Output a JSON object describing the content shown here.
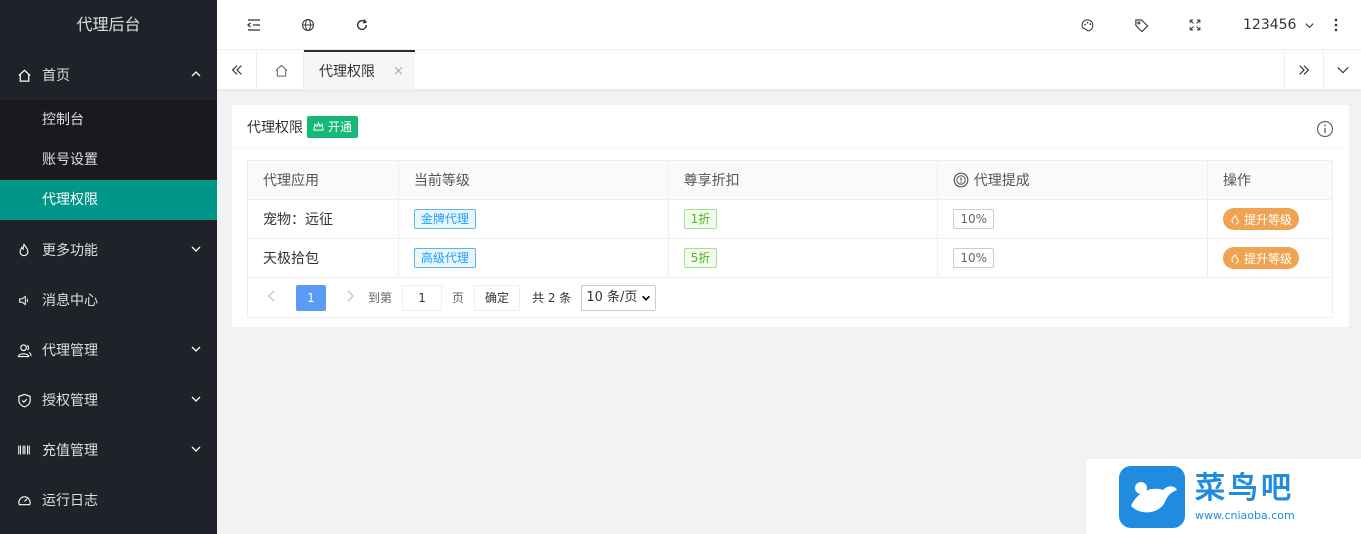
{
  "sidebar": {
    "logo": "代理后台",
    "home": "首页",
    "sub_items": [
      "控制台",
      "账号设置",
      "代理权限"
    ],
    "items": [
      {
        "label": "更多功能",
        "icon": "fire-icon"
      },
      {
        "label": "消息中心",
        "icon": "speaker-icon"
      },
      {
        "label": "代理管理",
        "icon": "users-icon"
      },
      {
        "label": "授权管理",
        "icon": "shield-icon"
      },
      {
        "label": "充值管理",
        "icon": "barcode-icon"
      },
      {
        "label": "运行日志",
        "icon": "gauge-icon"
      }
    ]
  },
  "header": {
    "username": "123456"
  },
  "tabs": {
    "active": "代理权限",
    "close": "×"
  },
  "card": {
    "title": "代理权限",
    "badge": "开通",
    "columns": [
      "代理应用",
      "当前等级",
      "尊享折扣",
      "代理提成",
      "操作"
    ],
    "rows": [
      {
        "app": "宠物：远征",
        "level": "金牌代理",
        "discount": "1折",
        "commission": "10%",
        "action": "提升等级"
      },
      {
        "app": "天极拾包",
        "level": "高级代理",
        "discount": "5折",
        "commission": "10%",
        "action": "提升等级"
      }
    ]
  },
  "pager": {
    "current": "1",
    "goto_label": "到第",
    "page_value": "1",
    "page_label": "页",
    "confirm": "确定",
    "total": "共 2 条",
    "per_page": "10 条/页"
  },
  "watermark": {
    "title": "菜鸟吧",
    "url": "www.cniaoba.com"
  },
  "colors": {
    "sidebar_bg": "#20222a",
    "active": "#009688",
    "badge_green": "#16b777",
    "action_orange": "#f0a452"
  }
}
